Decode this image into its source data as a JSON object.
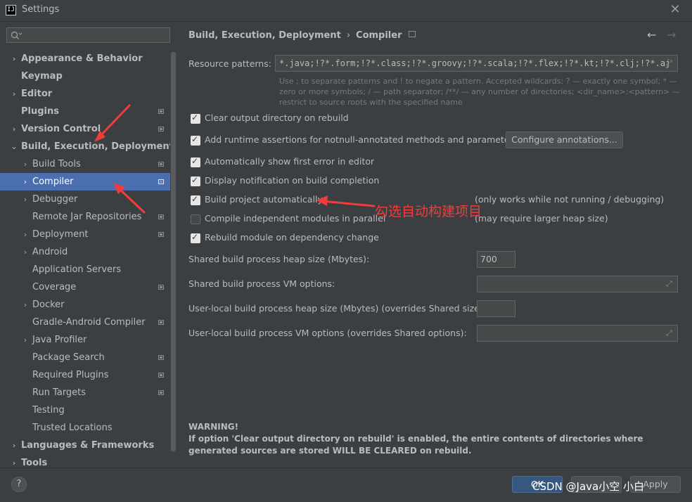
{
  "window": {
    "title": "Settings",
    "close_glyph": "✕"
  },
  "sidebar": {
    "search_placeholder": "",
    "items": [
      {
        "label": "Appearance & Behavior"
      },
      {
        "label": "Keymap"
      },
      {
        "label": "Editor"
      },
      {
        "label": "Plugins"
      },
      {
        "label": "Version Control"
      },
      {
        "label": "Build, Execution, Deployment"
      },
      {
        "label": "Build Tools"
      },
      {
        "label": "Compiler"
      },
      {
        "label": "Debugger"
      },
      {
        "label": "Remote Jar Repositories"
      },
      {
        "label": "Deployment"
      },
      {
        "label": "Android"
      },
      {
        "label": "Application Servers"
      },
      {
        "label": "Coverage"
      },
      {
        "label": "Docker"
      },
      {
        "label": "Gradle-Android Compiler"
      },
      {
        "label": "Java Profiler"
      },
      {
        "label": "Package Search"
      },
      {
        "label": "Required Plugins"
      },
      {
        "label": "Run Targets"
      },
      {
        "label": "Testing"
      },
      {
        "label": "Trusted Locations"
      },
      {
        "label": "Languages & Frameworks"
      },
      {
        "label": "Tools"
      }
    ]
  },
  "breadcrumb": {
    "parent": "Build, Execution, Deployment",
    "separator": "›",
    "current": "Compiler"
  },
  "nav": {
    "back": "←",
    "forward": "→"
  },
  "resource": {
    "label": "Resource patterns:",
    "value": "*.java;!?*.form;!?*.class;!?*.groovy;!?*.scala;!?*.flex;!?*.kt;!?*.clj;!?*.aj",
    "hint": "Use ; to separate patterns and ! to negate a pattern. Accepted wildcards: ? — exactly one symbol; * — zero or more symbols; / — path separator; /**/ — any number of directories; <dir_name>:<pattern> — restrict to source roots with the specified name"
  },
  "options": {
    "clear_output": "Clear output directory on rebuild",
    "runtime_assertions": "Add runtime assertions for notnull-annotated methods and parameters",
    "configure_annotations": "Configure annotations...",
    "show_first_error": "Automatically show first error in editor",
    "display_notification": "Display notification on build completion",
    "build_automatically": "Build project automatically",
    "build_automatically_note": "(only works while not running / debugging)",
    "compile_parallel": "Compile independent modules in parallel",
    "compile_parallel_note": "(may require larger heap size)",
    "rebuild_on_dependency": "Rebuild module on dependency change"
  },
  "fields": {
    "heap_label": "Shared build process heap size (Mbytes):",
    "heap_value": "700",
    "vm_label": "Shared build process VM options:",
    "user_heap_label": "User-local build process heap size (Mbytes) (overrides Shared size):",
    "user_vm_label": "User-local build process VM options (overrides Shared options):"
  },
  "warning": {
    "title": "WARNING!",
    "text": "If option 'Clear output directory on rebuild' is enabled, the entire contents of directories where generated sources are stored WILL BE CLEARED on rebuild."
  },
  "footer": {
    "help": "?",
    "ok": "OK",
    "apply": "Apply",
    "watermark": "CSDN @Java小空  小白"
  },
  "annotation": {
    "text": "勾选自动构建项目",
    "color": "#f23c3c"
  },
  "colors": {
    "selection": "#4b6eaf",
    "background": "#3c3f41",
    "ok_button": "#365880"
  }
}
